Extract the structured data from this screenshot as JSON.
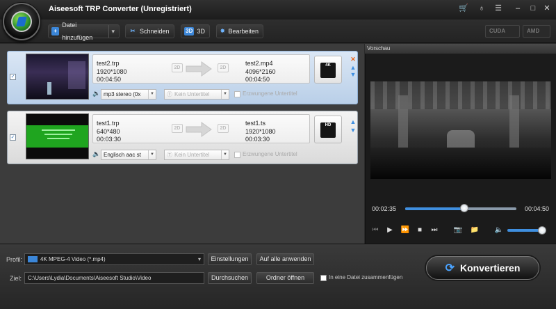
{
  "window": {
    "title": "Aiseesoft TRP Converter (Unregistriert)",
    "controls": [
      "🛒",
      "♁",
      "☰",
      "–",
      "□",
      "✕"
    ]
  },
  "toolbar": {
    "add_file": "Datei hinzufügen",
    "cut": "Schneiden",
    "threed": "3D",
    "edit": "Bearbeiten",
    "cuda": "CUDA",
    "amd": "AMD"
  },
  "files": [
    {
      "source_name": "test2.trp",
      "source_res": "1920*1080",
      "source_dur": "00:04:50",
      "target_name": "test2.mp4",
      "target_res": "4096*2160",
      "target_dur": "00:04:50",
      "audio": "mp3 stereo (0x",
      "subtitle": "Kein Untertitel",
      "forced": "Erzwungene Untertitel",
      "badge_left": "2D",
      "badge_right": "2D",
      "format_badge": "4K"
    },
    {
      "source_name": "test1.trp",
      "source_res": "640*480",
      "source_dur": "00:03:30",
      "target_name": "test1.ts",
      "target_res": "1920*1080",
      "target_dur": "00:03:30",
      "audio": "Englisch aac st",
      "subtitle": "Kein Untertitel",
      "forced": "Erzwungene Untertitel",
      "badge_left": "2D",
      "badge_right": "2D",
      "format_badge": "HD"
    }
  ],
  "preview": {
    "label": "Vorschau",
    "current_time": "00:02:35",
    "total_time": "00:04:50",
    "progress": 0.53,
    "volume": 0.9
  },
  "bottom": {
    "profile_label": "Profil:",
    "profile_value": "4K MPEG-4 Video (*.mp4)",
    "settings": "Einstellungen",
    "apply_all": "Auf alle anwenden",
    "dest_label": "Ziel:",
    "dest_value": "C:\\Users\\Lydia\\Documents\\Aiseesoft Studio\\Video",
    "browse": "Durchsuchen",
    "open_folder": "Ordner öffnen",
    "merge": "In eine Datei zusammenfügen",
    "convert": "Konvertieren"
  },
  "colors": {
    "accent": "#3f8fe0",
    "selected_row": "#c9dcf2",
    "remove": "#e8641a"
  }
}
